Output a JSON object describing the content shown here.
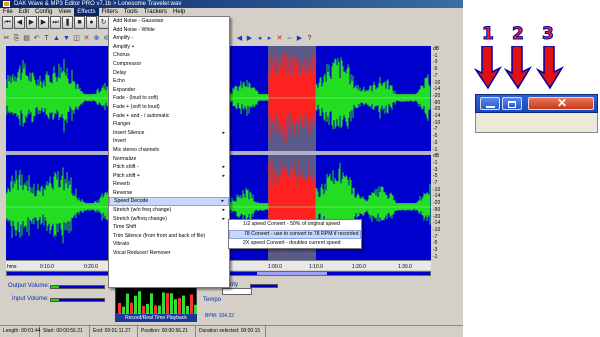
{
  "window": {
    "title": "DAK Wave & MP3 Editor PRO v7.1b > Lonesome Traveler.wav"
  },
  "menubar": {
    "items": [
      {
        "label": "File"
      },
      {
        "label": "Edit"
      },
      {
        "label": "Config"
      },
      {
        "label": "View"
      },
      {
        "label": "Effects"
      },
      {
        "label": "Filters"
      },
      {
        "label": "Tools"
      },
      {
        "label": "Trackers"
      },
      {
        "label": "Help"
      }
    ]
  },
  "effects_menu": {
    "items": [
      {
        "label": "Add Noise - Gaussian"
      },
      {
        "label": "Add Noise - White"
      },
      {
        "label": "Amplify -"
      },
      {
        "label": "Amplify +"
      },
      {
        "label": "Chorus"
      },
      {
        "label": "Compressor"
      },
      {
        "label": "Delay"
      },
      {
        "label": "Echo"
      },
      {
        "label": "Expander"
      },
      {
        "label": "Fade - (loud to soft)"
      },
      {
        "label": "Fade + (soft to loud)"
      },
      {
        "label": "Fade + and - / automatic"
      },
      {
        "label": "Flanger"
      },
      {
        "label": "Insert Silence",
        "submenu": true
      },
      {
        "label": "Invert"
      },
      {
        "label": "Mix stereo channels"
      },
      {
        "label": "Normalize"
      },
      {
        "label": "Pitch shift -",
        "submenu": true
      },
      {
        "label": "Pitch shift +",
        "submenu": true
      },
      {
        "label": "Reverb"
      },
      {
        "label": "Reverse"
      },
      {
        "label": "Speed Decode",
        "submenu": true,
        "highlighted": true
      },
      {
        "label": "Stretch (w/o freq change)",
        "submenu": true
      },
      {
        "label": "Stretch (w/freq change)",
        "submenu": true
      },
      {
        "label": "Time Shift"
      },
      {
        "label": "Trim Silence (from front and back of file)"
      },
      {
        "label": "Vibrato"
      },
      {
        "label": "Vocal Reducer/ Remover"
      }
    ]
  },
  "speed_submenu": {
    "items": [
      {
        "label": "1/2 speed Convert - 50% of original speed"
      },
      {
        "label": "78 Convert - use to convert to 78 RPM if recorded as 45",
        "highlighted": true
      },
      {
        "label": "2X speed Convert - doubles current speed"
      }
    ]
  },
  "scale_labels": [
    "dB",
    "-1",
    "-3",
    "-5",
    "-7",
    "-10",
    "-14",
    "-20",
    "-90",
    "-20",
    "-14",
    "-10",
    "-7",
    "-5",
    "-3",
    "-1",
    "dB",
    "-1",
    "-3",
    "-5",
    "-7",
    "-10",
    "-14",
    "-20",
    "-90",
    "-20",
    "-14",
    "-10",
    "-7",
    "-5",
    "-3",
    "-1"
  ],
  "time_ruler": [
    "hms",
    "0:10.0",
    "0:20.0",
    "1:00.0",
    "1:10.0",
    "1:20.0",
    "1:30.0"
  ],
  "levels": {
    "output_label": "Output Volume:",
    "input_label": "Input Volume:",
    "tempo_label": "Tempo",
    "record_label": "Record/Real Time Playback",
    "bpm_label": "BPM: 104.22",
    "partial_label": "rity"
  },
  "status": {
    "length": "Length: 00:01:44",
    "start": "Start: 00:00:56.21",
    "end": "End: 00:01:11.27",
    "position": "Position: 00:00:56.21",
    "duration": "Duration selected: 00:00:15"
  },
  "callout": {
    "numbers": [
      "1",
      "2",
      "3"
    ],
    "colors": {
      "number": "#ff2020",
      "arrow": "#e01010",
      "outline": "#0000aa"
    }
  },
  "colors": {
    "waveform": "#22dd22",
    "waveform_selected": "#ff2020",
    "wave_bg": "#0000cc",
    "selection_bg": "#5a5a8a",
    "menu_highlight": "#c8d8f8"
  }
}
